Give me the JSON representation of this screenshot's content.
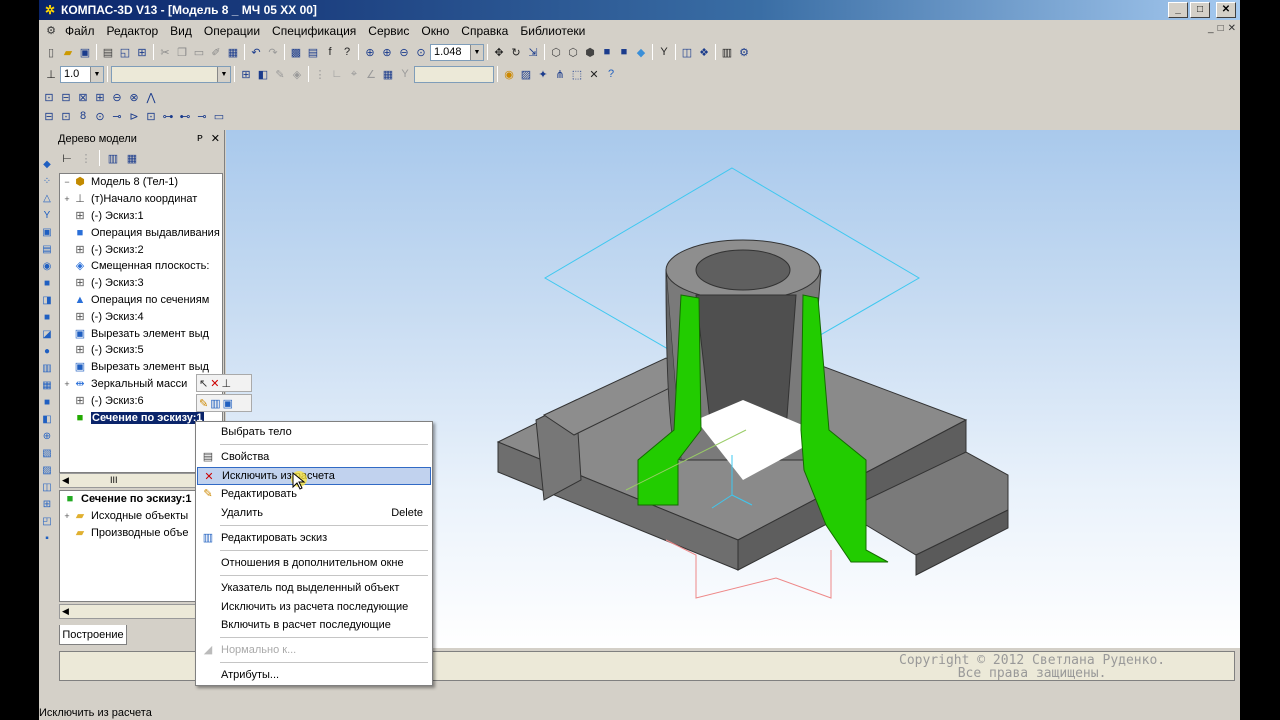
{
  "window": {
    "title": "КОМПАС-3D V13 - [Модель 8 _ МЧ 05 XX 00]",
    "controls": [
      "_",
      "□",
      "✕"
    ],
    "mdi_controls": [
      "_",
      "□",
      "✕"
    ]
  },
  "menu": [
    "Файл",
    "Редактор",
    "Вид",
    "Операции",
    "Спецификация",
    "Сервис",
    "Окно",
    "Справка",
    "Библиотеки"
  ],
  "toolbar": {
    "zoom_value": "1.048",
    "line_scale_value": "1.0"
  },
  "tree_panel": {
    "title": "Дерево модели",
    "pin": "ᴘ",
    "close": "✕",
    "root": "Модель 8 (Тел-1)",
    "items": [
      {
        "label": "(т)Начало координат",
        "expand": "+",
        "icon": "axis"
      },
      {
        "label": "(-) Эскиз:1",
        "expand": "",
        "icon": "sketch"
      },
      {
        "label": "Операция выдавливания",
        "expand": "",
        "icon": "extrude"
      },
      {
        "label": "(-) Эскиз:2",
        "expand": "",
        "icon": "sketch"
      },
      {
        "label": "Смещенная плоскость:",
        "expand": "",
        "icon": "plane"
      },
      {
        "label": "(-) Эскиз:3",
        "expand": "",
        "icon": "sketch"
      },
      {
        "label": "Операция по сечениям",
        "expand": "",
        "icon": "loft"
      },
      {
        "label": "(-) Эскиз:4",
        "expand": "",
        "icon": "sketch"
      },
      {
        "label": "Вырезать элемент выд",
        "expand": "",
        "icon": "cut"
      },
      {
        "label": "(-) Эскиз:5",
        "expand": "",
        "icon": "sketch"
      },
      {
        "label": "Вырезать элемент выд",
        "expand": "",
        "icon": "cut"
      },
      {
        "label": "Зеркальный масси",
        "expand": "+",
        "icon": "mirror"
      },
      {
        "label": "(-) Эскиз:6",
        "expand": "",
        "icon": "sketch"
      },
      {
        "label": "Сечение по эскизу:1",
        "expand": "",
        "icon": "section",
        "selected": true
      }
    ],
    "scroll_glyph": "III",
    "lower_root": "Сечение по эскизу:1",
    "lower_items": [
      {
        "label": "Исходные объекты",
        "expand": "+"
      },
      {
        "label": "Производные объе",
        "expand": ""
      }
    ],
    "tab": "Построение"
  },
  "context_menu": {
    "items": [
      {
        "label": "Выбрать тело",
        "shortcut": "",
        "icon": "",
        "disabled": false,
        "highlight": false
      },
      {
        "label": "Свойства",
        "shortcut": "",
        "icon": "props",
        "disabled": false,
        "highlight": false
      },
      {
        "label": "Исключить из расчета",
        "shortcut": "",
        "icon": "exclude",
        "disabled": false,
        "highlight": true
      },
      {
        "label": "Редактировать",
        "shortcut": "",
        "icon": "pencil",
        "disabled": false,
        "highlight": false
      },
      {
        "label": "Удалить",
        "shortcut": "Delete",
        "icon": "",
        "disabled": false,
        "highlight": false
      },
      {
        "label": "Редактировать эскиз",
        "shortcut": "",
        "icon": "sketchedit",
        "disabled": false,
        "highlight": false
      },
      {
        "label": "Отношения в дополнительном окне",
        "shortcut": "",
        "icon": "",
        "disabled": false,
        "highlight": false
      },
      {
        "label": "Указатель под выделенный объект",
        "shortcut": "",
        "icon": "",
        "disabled": false,
        "highlight": false
      },
      {
        "label": "Исключить из расчета последующие",
        "shortcut": "",
        "icon": "",
        "disabled": false,
        "highlight": false
      },
      {
        "label": "Включить в расчет последующие",
        "shortcut": "",
        "icon": "",
        "disabled": false,
        "highlight": false
      },
      {
        "label": "Нормально к...",
        "shortcut": "",
        "icon": "normal",
        "disabled": true,
        "highlight": false
      },
      {
        "label": "Атрибуты...",
        "shortcut": "",
        "icon": "",
        "disabled": false,
        "highlight": false
      }
    ]
  },
  "watermark": {
    "line1": "Copyright © 2012 Светлана Руденко.",
    "line2": "Все права защищены."
  },
  "status_text": "Исключить из расчета",
  "colors": {
    "title_gradient_start": "#0a246a",
    "section_green": "#22cc00",
    "model_gray": "#7d7d7d",
    "plane_cyan": "#3ec8f0",
    "selection": "#0a246a"
  }
}
